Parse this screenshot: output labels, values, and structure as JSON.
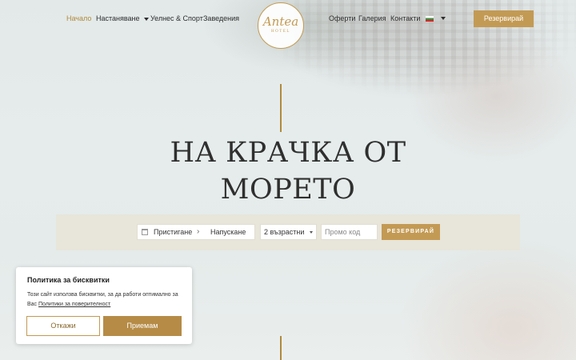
{
  "nav": {
    "home": "Начало",
    "accommodation": "Настаняване",
    "wellness": "Уелнес & Спорт",
    "venues": "Заведения",
    "offers": "Оферти",
    "gallery": "Галерия",
    "contacts": "Контакти",
    "reserve_label": "Резервирай",
    "language_flag": "bulgarian-flag"
  },
  "logo": {
    "script": "Antea",
    "sub": "HOTEL"
  },
  "hero": {
    "headline_line1": "НА КРАЧКА ОТ",
    "headline_line2": "МОРЕТО"
  },
  "booking": {
    "arrival": "Пристигане",
    "separator": "›",
    "departure": "Напускане",
    "guests": "2 възрастни",
    "promo_placeholder": "Промо код",
    "button": "РЕЗЕРВИРАЙ"
  },
  "cookie": {
    "title": "Политика за бисквитки",
    "text": "Този сайт използва бисквитки, за да работи оптимално за Вас",
    "link": "Политики за поверителност",
    "decline": "Откажи",
    "accept": "Приемам"
  },
  "colors": {
    "accent": "#c39a54",
    "active_nav": "#b18a3c"
  }
}
